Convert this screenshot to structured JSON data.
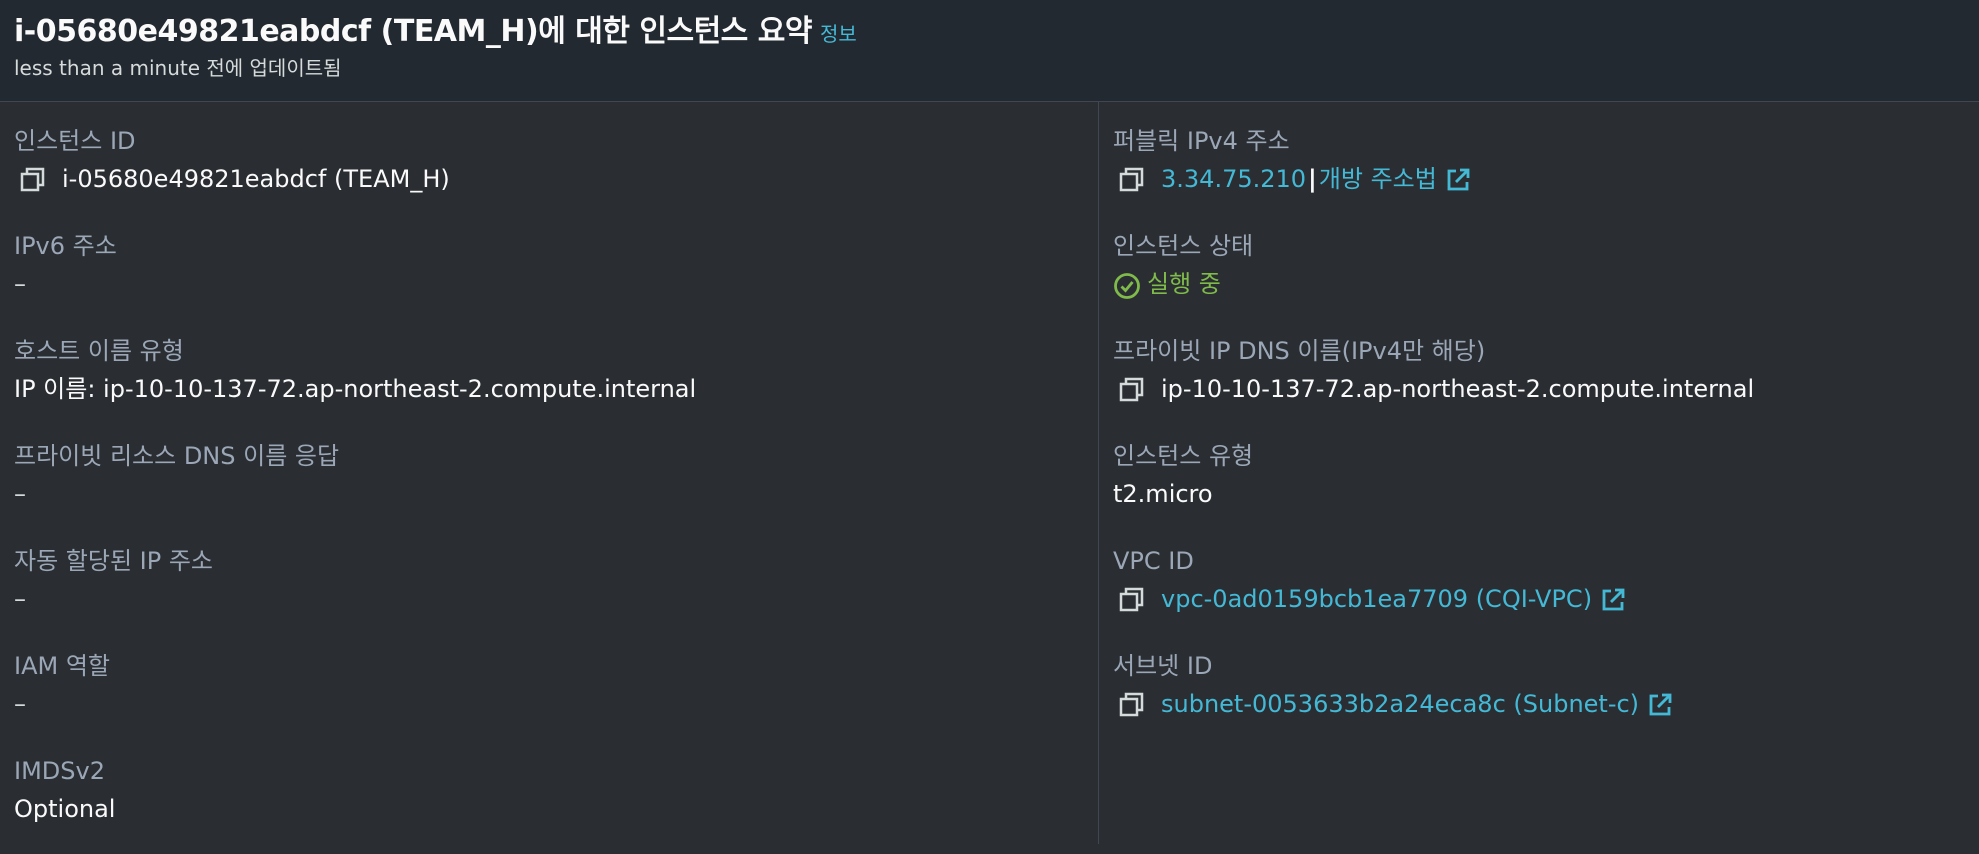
{
  "header": {
    "title": "i-05680e49821eabdcf (TEAM_H)에 대한 인스턴스 요약",
    "info_link": "정보",
    "subtitle": "less than a minute 전에 업데이트됨"
  },
  "left": {
    "instance_id": {
      "label": "인스턴스 ID",
      "value": "i-05680e49821eabdcf (TEAM_H)"
    },
    "ipv6": {
      "label": "IPv6 주소",
      "value": "–"
    },
    "hostname_type": {
      "label": "호스트 이름 유형",
      "value": "IP 이름: ip-10-10-137-72.ap-northeast-2.compute.internal"
    },
    "private_dns_answer": {
      "label": "프라이빗 리소스 DNS 이름 응답",
      "value": "–"
    },
    "auto_ip": {
      "label": "자동 할당된 IP 주소",
      "value": "–"
    },
    "iam_role": {
      "label": "IAM 역할",
      "value": "–"
    },
    "imdsv2": {
      "label": "IMDSv2",
      "value": "Optional"
    }
  },
  "right": {
    "public_ipv4": {
      "label": "퍼블릭 IPv4 주소",
      "value": "3.34.75.210",
      "separator": "|",
      "open_link": "개방 주소법"
    },
    "instance_state": {
      "label": "인스턴스 상태",
      "value": "실행 중"
    },
    "private_dns": {
      "label": "프라이빗 IP DNS 이름(IPv4만 해당)",
      "value": "ip-10-10-137-72.ap-northeast-2.compute.internal"
    },
    "instance_type": {
      "label": "인스턴스 유형",
      "value": "t2.micro"
    },
    "vpc_id": {
      "label": "VPC ID",
      "value": "vpc-0ad0159bcb1ea7709 (CQI-VPC)"
    },
    "subnet_id": {
      "label": "서브넷 ID",
      "value": "subnet-0053633b2a24eca8c (Subnet-c)"
    }
  },
  "colors": {
    "background": "#2a2e33",
    "header_background": "#232930",
    "link": "#44b9d6",
    "label": "#9ba7b6",
    "value": "#fafafa",
    "status_running": "#7fba4a"
  },
  "icons": [
    "copy-icon",
    "external-link-icon",
    "check-circle-icon"
  ]
}
